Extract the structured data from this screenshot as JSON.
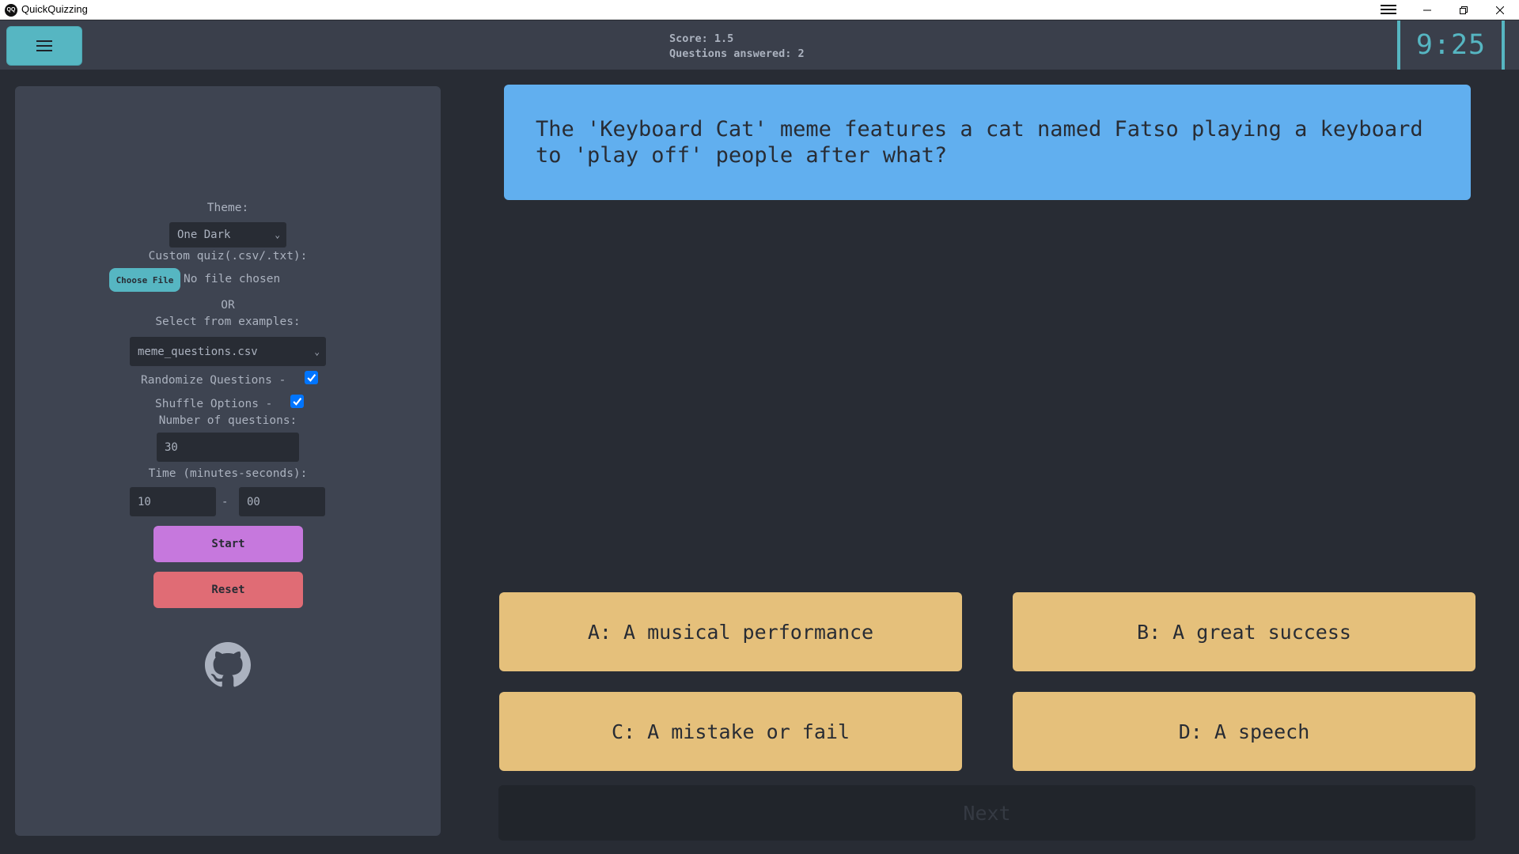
{
  "window": {
    "title": "QuickQuizzing",
    "icon_text": "QQ",
    "controls": [
      "minimize",
      "restore",
      "close"
    ]
  },
  "header": {
    "menu_icon": "hamburger-icon",
    "score_line": "Score: 1.5",
    "answered_line": "Questions answered: 2",
    "timer": "9:25"
  },
  "sidebar": {
    "theme_label": "Theme:",
    "theme_value": "One Dark",
    "custom_quiz_label": "Custom quiz(.csv/.txt):",
    "choose_file_label": "Choose File",
    "no_file_text": "No file chosen",
    "or_text": "OR",
    "examples_label": "Select from examples:",
    "examples_value": "meme_questions.csv",
    "randomize_label": "Randomize Questions -",
    "randomize_checked": true,
    "shuffle_label": "Shuffle Options -",
    "shuffle_checked": true,
    "num_questions_label": "Number of questions:",
    "num_questions_value": "30",
    "time_label": "Time (minutes-seconds):",
    "time_minutes": "10",
    "time_separator": "-",
    "time_seconds": "00",
    "start_label": "Start",
    "reset_label": "Reset",
    "github_icon": "github-icon"
  },
  "quiz": {
    "question": "The 'Keyboard Cat' meme features a cat named Fatso playing a keyboard to 'play off' people after what?",
    "options": [
      "A: A musical performance",
      "B: A great success",
      "C: A mistake or fail",
      "D: A speech"
    ],
    "next_label": "Next"
  },
  "colors": {
    "background": "#282c34",
    "panel": "#3e4451",
    "accent": "#56b6c2",
    "question_bg": "#61afef",
    "option_bg": "#e5c07b",
    "start_bg": "#c678dd",
    "reset_bg": "#e06c75"
  }
}
